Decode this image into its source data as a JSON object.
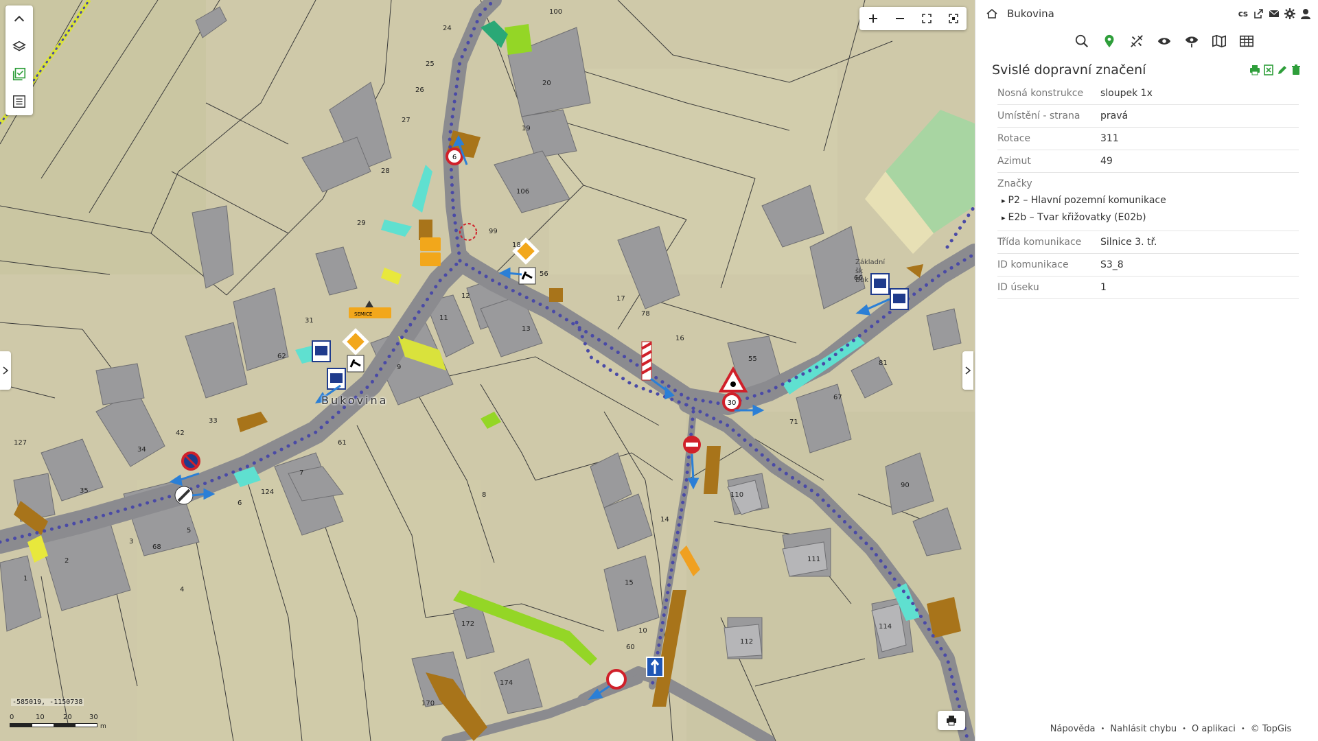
{
  "map": {
    "coordinates": "-585019, -1150738",
    "scale": {
      "labels": [
        "0",
        "10",
        "20",
        "30"
      ],
      "unit": "m"
    },
    "place_label": "Bukovina",
    "school_label": [
      "Základní",
      "šk",
      "Buk"
    ],
    "sign_texts": {
      "direction_plate": "SEMICE"
    },
    "parcel_numbers": [
      "100",
      "24",
      "25",
      "26",
      "27",
      "28",
      "29",
      "20",
      "19",
      "106",
      "99",
      "18",
      "56",
      "17",
      "78",
      "16",
      "55",
      "12",
      "11",
      "13",
      "31",
      "62",
      "9",
      "33",
      "42",
      "34",
      "35",
      "61",
      "124",
      "7",
      "8",
      "6",
      "5",
      "3",
      "68",
      "2",
      "1",
      "4",
      "172",
      "170",
      "174",
      "14",
      "15",
      "10",
      "60",
      "110",
      "111",
      "112",
      "114",
      "90",
      "81",
      "67",
      "71",
      "66",
      "127"
    ],
    "controls": {
      "collapse": "chevron-up-icon",
      "layers": "layers-icon",
      "legend": "checklist-icon",
      "table": "list-icon",
      "zoom_in": "plus-icon",
      "zoom_out": "minus-icon",
      "full_extent": "expand-icon",
      "fullscreen": "fullscreen-icon",
      "print": "print-icon"
    }
  },
  "panel": {
    "header": {
      "title": "Bukovina",
      "lang": "cs"
    },
    "detail": {
      "title": "Svislé dopravní značení",
      "attributes": [
        {
          "key": "Nosná konstrukce",
          "value": "sloupek 1x"
        },
        {
          "key": "Umístění - strana",
          "value": "pravá"
        },
        {
          "key": "Rotace",
          "value": "311"
        },
        {
          "key": "Azimut",
          "value": "49"
        }
      ],
      "signs_label": "Značky",
      "signs": [
        "P2 – Hlavní pozemní komunikace",
        "E2b – Tvar křižovatky (E02b)"
      ],
      "attributes2": [
        {
          "key": "Třída komunikace",
          "value": "Silnice 3. tř."
        },
        {
          "key": "ID komunikace",
          "value": "S3_8"
        },
        {
          "key": "ID úseku",
          "value": "1"
        }
      ]
    },
    "footer": {
      "help": "Nápověda",
      "report": "Nahlásit chybu",
      "about": "O aplikaci",
      "copyright": "© TopGis"
    },
    "colors": {
      "accent_green": "#2e9e3a",
      "road_dots": "#4a4aa6"
    }
  }
}
